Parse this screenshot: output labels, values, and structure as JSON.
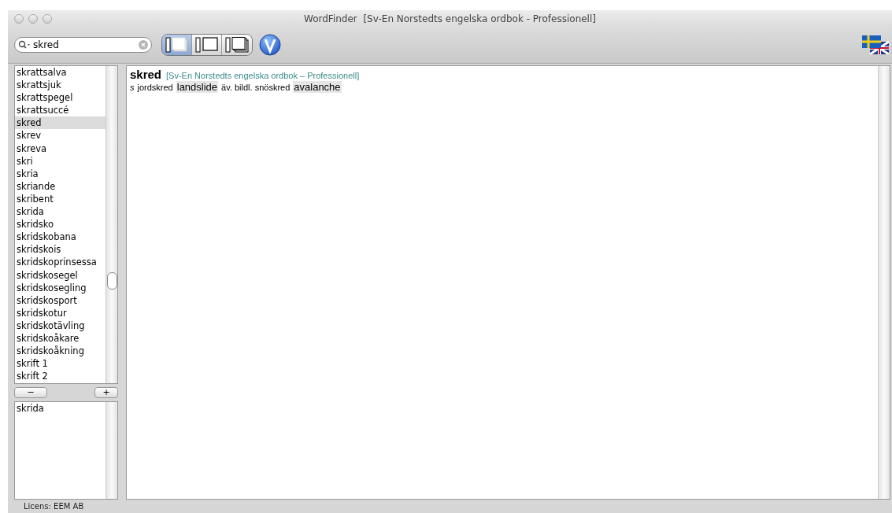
{
  "window": {
    "title": "WordFinder  [Sv-En Norstedts engelska ordbok - Professionell]"
  },
  "search": {
    "value": "skred"
  },
  "view_modes": [
    {
      "selected": true
    },
    {
      "selected": false
    },
    {
      "selected": false
    }
  ],
  "word_list": [
    {
      "label": "skrattsalva",
      "selected": false
    },
    {
      "label": "skrattsjuk",
      "selected": false
    },
    {
      "label": "skrattspegel",
      "selected": false
    },
    {
      "label": "skrattsuccé",
      "selected": false
    },
    {
      "label": "skred",
      "selected": true
    },
    {
      "label": "skrev",
      "selected": false
    },
    {
      "label": "skreva",
      "selected": false
    },
    {
      "label": "skri",
      "selected": false
    },
    {
      "label": "skria",
      "selected": false
    },
    {
      "label": "skriande",
      "selected": false
    },
    {
      "label": "skribent",
      "selected": false
    },
    {
      "label": "skrida",
      "selected": false
    },
    {
      "label": "skridsko",
      "selected": false
    },
    {
      "label": "skridskobana",
      "selected": false
    },
    {
      "label": "skridskois",
      "selected": false
    },
    {
      "label": "skridskoprinsessa",
      "selected": false
    },
    {
      "label": "skridskosegel",
      "selected": false
    },
    {
      "label": "skridskosegling",
      "selected": false
    },
    {
      "label": "skridskosport",
      "selected": false
    },
    {
      "label": "skridskotur",
      "selected": false
    },
    {
      "label": "skridskotävling",
      "selected": false
    },
    {
      "label": "skridskoåkare",
      "selected": false
    },
    {
      "label": "skridskoåkning",
      "selected": false
    },
    {
      "label": "skrift 1",
      "selected": false
    },
    {
      "label": "skrift 2",
      "selected": false
    }
  ],
  "buttons": [
    "−",
    "+"
  ],
  "history_list": [
    {
      "label": "skrida"
    }
  ],
  "entry": {
    "headword": "skred",
    "source": "[Sv-En Norstedts engelska ordbok – Professionell]",
    "segments": [
      {
        "kind": "grammar",
        "text": "s"
      },
      {
        "kind": "text",
        "text": "jordskred"
      },
      {
        "kind": "translation",
        "text": "landslide"
      },
      {
        "kind": "text",
        "text": "äv. bildl. snöskred"
      },
      {
        "kind": "translation",
        "text": "avalanche"
      }
    ]
  },
  "status_bar": "Licens: EEM AB"
}
